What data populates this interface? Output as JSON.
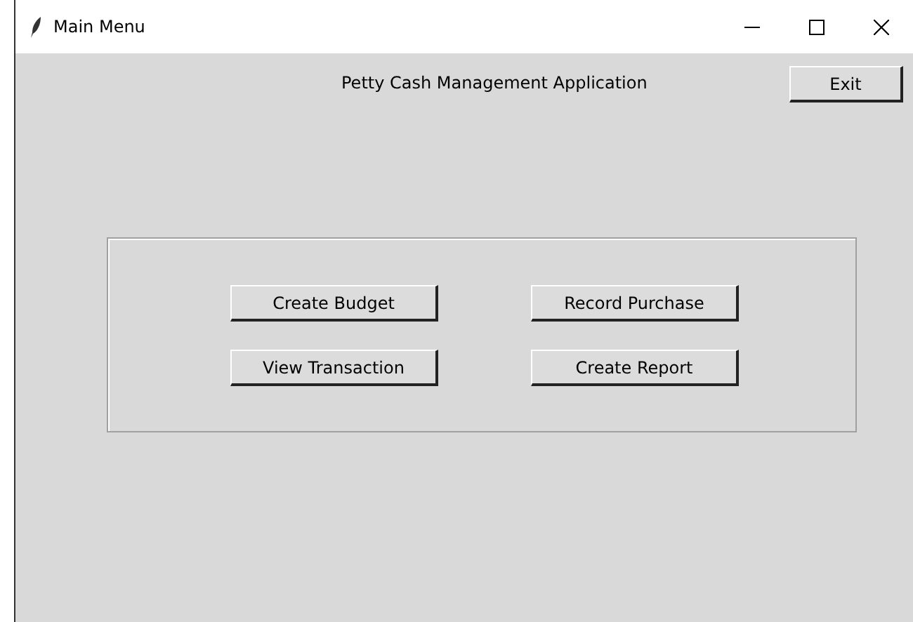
{
  "window": {
    "title": "Main Menu"
  },
  "heading": "Petty Cash Management Application",
  "exit_button": "Exit",
  "menu_buttons": [
    {
      "label": "Create Budget"
    },
    {
      "label": "Record Purchase"
    },
    {
      "label": "View Transaction"
    },
    {
      "label": "Create Report"
    }
  ]
}
